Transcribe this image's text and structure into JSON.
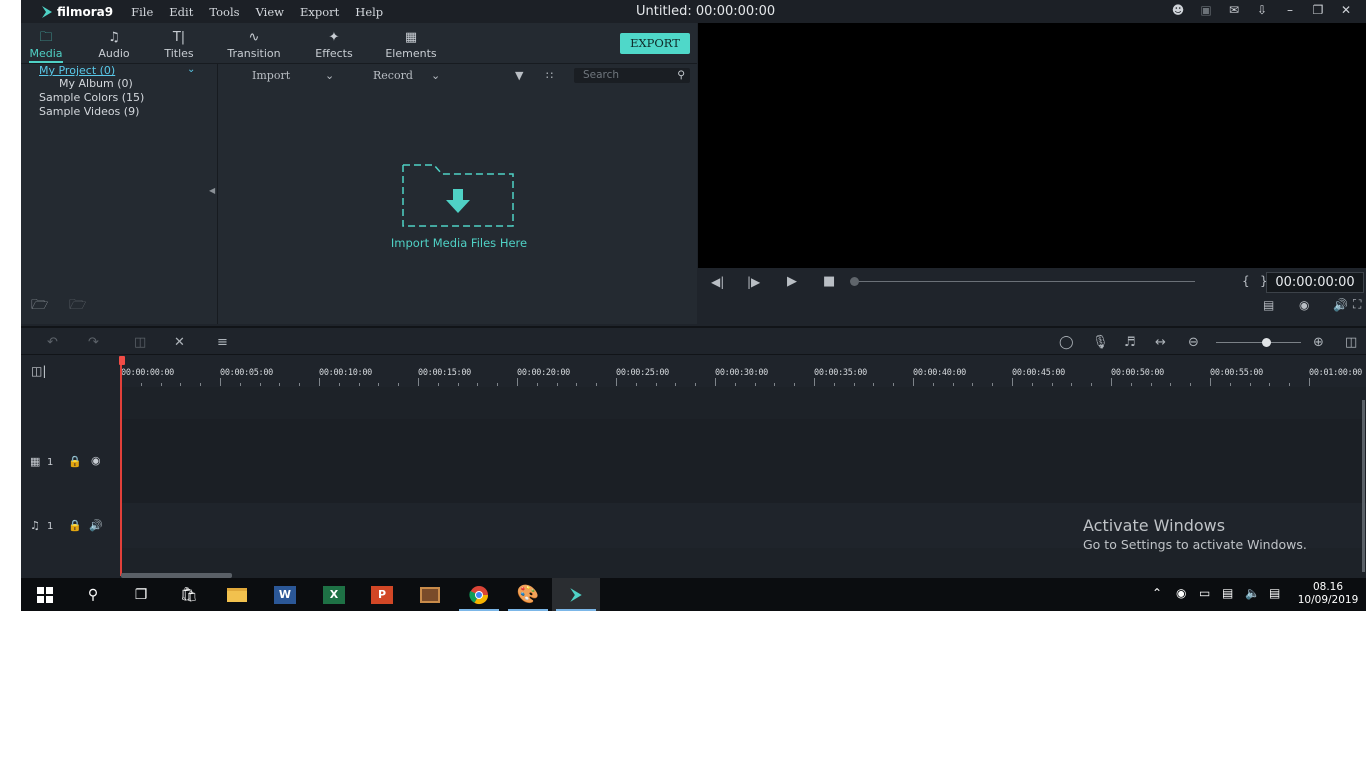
{
  "app": {
    "name": "filmora9",
    "title": "Untitled:",
    "title_time": "00:00:00:00",
    "menu": [
      "File",
      "Edit",
      "Tools",
      "View",
      "Export",
      "Help"
    ]
  },
  "tabs": [
    {
      "label": "Media",
      "icon": "folder-icon"
    },
    {
      "label": "Audio",
      "icon": "music-note-icon"
    },
    {
      "label": "Titles",
      "icon": "text-icon"
    },
    {
      "label": "Transition",
      "icon": "transition-icon"
    },
    {
      "label": "Effects",
      "icon": "effects-icon"
    },
    {
      "label": "Elements",
      "icon": "image-icon"
    }
  ],
  "export_label": "EXPORT",
  "folders": [
    {
      "label": "My Project (0)"
    },
    {
      "label": "My Album (0)"
    },
    {
      "label": "Sample Colors (15)"
    },
    {
      "label": "Sample Videos (9)"
    }
  ],
  "media_toolbar": {
    "import_label": "Import",
    "record_label": "Record",
    "search_placeholder": "Search"
  },
  "drop_label": "Import Media Files Here",
  "player": {
    "timecode": "00:00:00:00",
    "progress": 0
  },
  "timeline": {
    "ruler": [
      "00:00:00:00",
      "00:00:05:00",
      "00:00:10:00",
      "00:00:15:00",
      "00:00:20:00",
      "00:00:25:00",
      "00:00:30:00",
      "00:00:35:00",
      "00:00:40:00",
      "00:00:45:00",
      "00:00:50:00",
      "00:00:55:00",
      "00:01:00:00"
    ],
    "video_track": "1",
    "audio_track": "1",
    "zoom_level": 0.6
  },
  "watermark": {
    "line1": "Activate Windows",
    "line2": "Go to Settings to activate Windows."
  },
  "clock": {
    "time": "08.16",
    "date": "10/09/2019"
  },
  "colors": {
    "accent": "#4fd1c5",
    "background": "#1f242b",
    "playhead": "#e2403a"
  }
}
